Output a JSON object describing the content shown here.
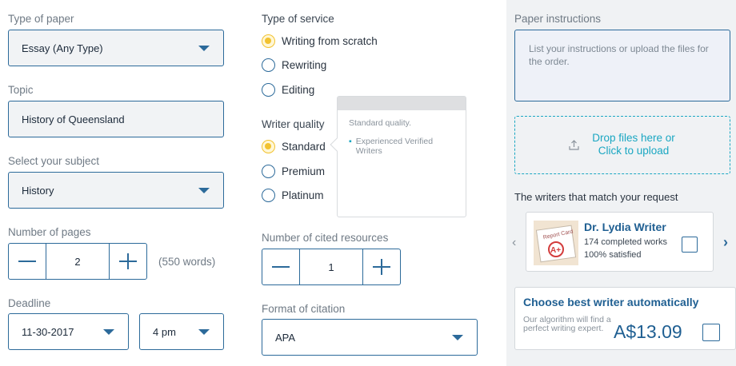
{
  "col1": {
    "paper_type_label": "Type of paper",
    "paper_type_value": "Essay (Any Type)",
    "topic_label": "Topic",
    "topic_value": "History of Queensland",
    "subject_label": "Select your subject",
    "subject_value": "History",
    "pages_label": "Number of pages",
    "pages_value": "2",
    "pages_words": "(550 words)",
    "deadline_label": "Deadline",
    "deadline_date": "11-30-2017",
    "deadline_time": "4 pm"
  },
  "col2": {
    "service_label": "Type of service",
    "service_options": [
      "Writing from scratch",
      "Rewriting",
      "Editing"
    ],
    "quality_label": "Writer quality",
    "quality_options": [
      "Standard",
      "Premium",
      "Platinum"
    ],
    "tooltip_title": "Standard quality.",
    "tooltip_bullet": "Experienced Verified Writers",
    "cited_label": "Number of cited resources",
    "cited_value": "1",
    "citation_label": "Format of citation",
    "citation_value": "APA"
  },
  "col3": {
    "instructions_label": "Paper instructions",
    "instructions_placeholder": "List your instructions or upload the files for the order.",
    "upload_line1": "Drop files here or",
    "upload_line2": "Click to upload",
    "writers_heading": "The writers that match your request",
    "writer_name": "Dr. Lydia Writer",
    "writer_works": "174 completed works",
    "writer_satisfied": "100% satisfied",
    "writer_image_text": "Report Card",
    "writer_image_grade": "A+",
    "auto_title": "Choose best writer automatically",
    "auto_desc": "Our algorithm will find a perfect writing expert.",
    "price": "A$13.09"
  },
  "colors": {
    "accent": "#2c6a9a",
    "selected": "#f2c230",
    "link": "#1aa7c2",
    "panel": "#f0f2f4"
  }
}
